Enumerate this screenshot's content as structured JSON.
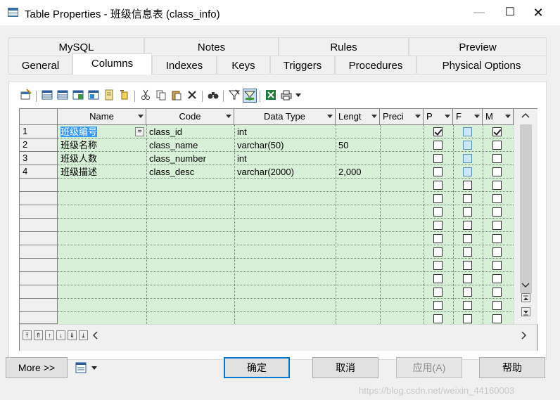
{
  "window": {
    "title": "Table Properties - 班级信息表 (class_info)",
    "min_glyph": "—",
    "max_glyph": "☐",
    "close_glyph": "✕"
  },
  "tabs": {
    "row1": [
      "MySQL",
      "Notes",
      "Rules",
      "Preview"
    ],
    "row2": [
      "General",
      "Columns",
      "Indexes",
      "Keys",
      "Triggers",
      "Procedures",
      "Physical Options"
    ],
    "active": "Columns"
  },
  "toolbar": {
    "icons": [
      "properties-icon",
      "insert-row-icon",
      "add-row-icon",
      "add-columns-icon",
      "reuse-columns-icon",
      "copy-icon",
      "paste-icon",
      "cut-icon",
      "copy2-icon",
      "paste2-icon",
      "delete-icon",
      "find-icon",
      "filter-icon",
      "filter-clear-icon",
      "export-excel-icon",
      "print-icon",
      "dropdown-icon"
    ]
  },
  "grid": {
    "headers": [
      "Name",
      "Code",
      "Data Type",
      "Lengt",
      "Preci",
      "P",
      "F",
      "M"
    ],
    "rows": [
      {
        "num": "1",
        "name": "班级编号",
        "code": "class_id",
        "type": "int",
        "length": "",
        "precision": "",
        "p": true,
        "f": false,
        "m": true
      },
      {
        "num": "2",
        "name": "班级名称",
        "code": "class_name",
        "type": "varchar(50)",
        "length": "50",
        "precision": "",
        "p": false,
        "f": false,
        "m": false
      },
      {
        "num": "3",
        "name": "班级人数",
        "code": "class_number",
        "type": "int",
        "length": "",
        "precision": "",
        "p": false,
        "f": false,
        "m": false
      },
      {
        "num": "4",
        "name": "班级描述",
        "code": "class_desc",
        "type": "varchar(2000)",
        "length": "2,000",
        "precision": "",
        "p": false,
        "f": false,
        "m": false
      }
    ],
    "empty_rows": 11,
    "cell_button": "="
  },
  "buttons": {
    "more": "More >>",
    "ok": "确定",
    "cancel": "取消",
    "apply": "应用(A)",
    "help": "帮助"
  },
  "watermark": "https://blog.csdn.net/weixin_44160003"
}
